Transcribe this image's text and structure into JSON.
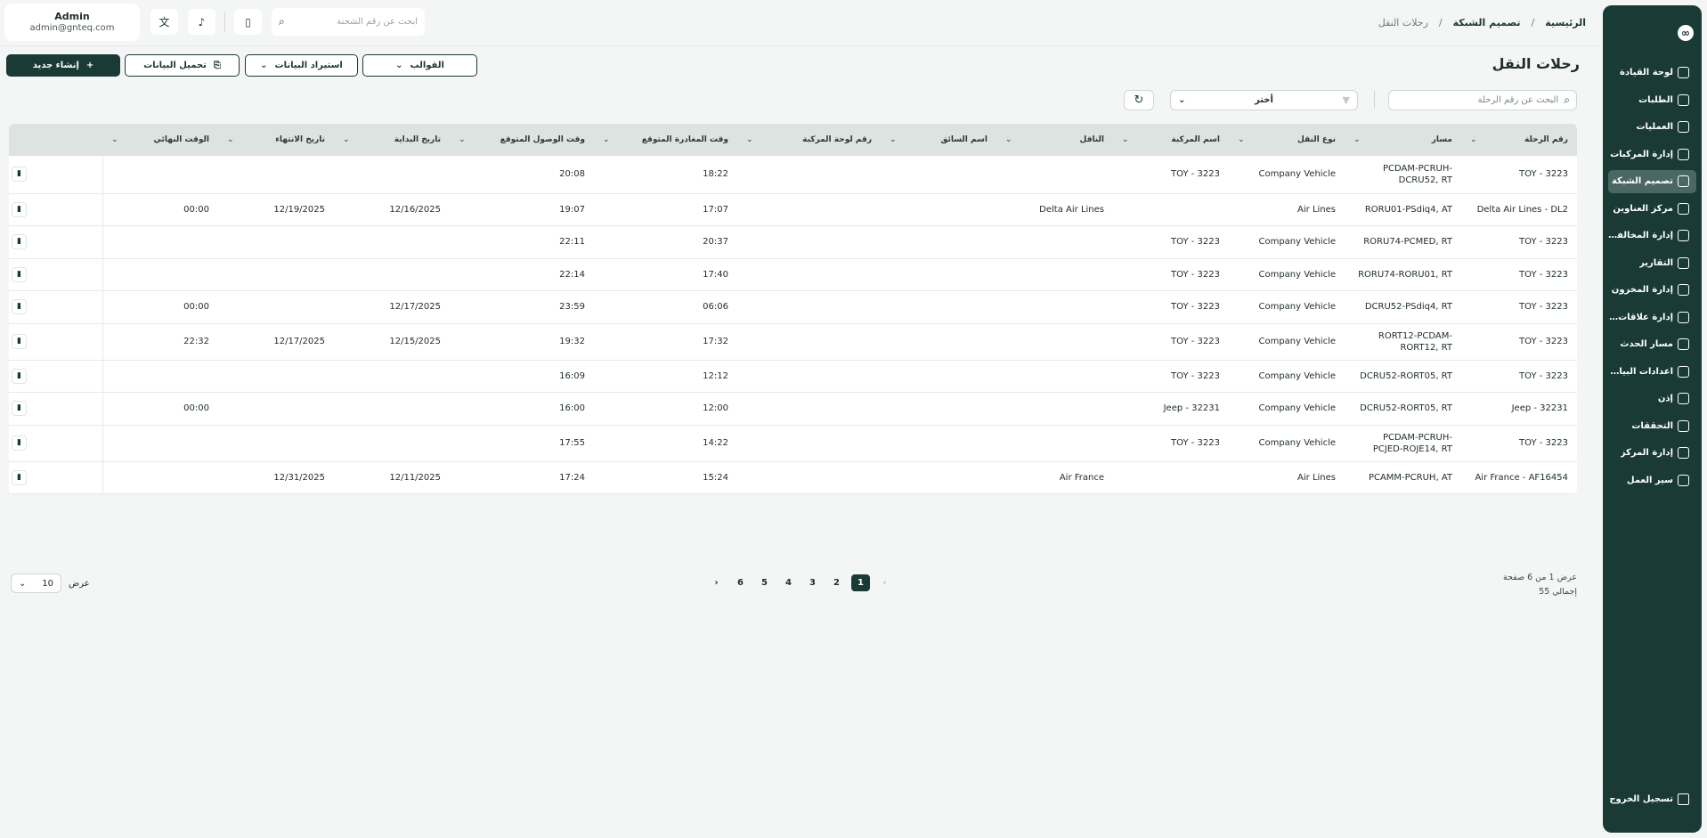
{
  "sidebar": {
    "logo": "∞",
    "items": [
      {
        "label": "لوحة القيادة",
        "icon": "dashboard-icon"
      },
      {
        "label": "الطلبات",
        "icon": "orders-icon"
      },
      {
        "label": "العمليات",
        "icon": "operations-icon"
      },
      {
        "label": "إدارة المركبات",
        "icon": "truck-icon"
      },
      {
        "label": "تصميم الشبكة",
        "icon": "network-icon",
        "active": true
      },
      {
        "label": "مركز العناوين",
        "icon": "location-icon"
      },
      {
        "label": "إدارة المخالفات",
        "icon": "violations-icon"
      },
      {
        "label": "التقارير",
        "icon": "reports-icon"
      },
      {
        "label": "إدارة المخزون",
        "icon": "inventory-icon"
      },
      {
        "label": "إدارة علاقات العملاء",
        "icon": "crm-icon"
      },
      {
        "label": "مسار الحدث",
        "icon": "route-icon"
      },
      {
        "label": "اعدادات البيانات...",
        "icon": "database-icon"
      },
      {
        "label": "إذن",
        "icon": "user-icon"
      },
      {
        "label": "التحققات",
        "icon": "tools-icon"
      },
      {
        "label": "إدارة المركز",
        "icon": "hub-icon"
      },
      {
        "label": "سير العمل",
        "icon": "workflow-icon"
      }
    ],
    "logout": "تسجيل الخروج"
  },
  "header": {
    "breadcrumb": [
      "الرئيسية",
      "/",
      "تصميم الشبكة",
      "/",
      "رحلات النقل"
    ],
    "search_placeholder": "ابحث عن رقم الشحنة",
    "user": {
      "name": "Admin",
      "email": "admin@gnteq.com"
    }
  },
  "page": {
    "title": "رحلات النقل",
    "buttons": {
      "templates": "القوالب",
      "import": "استيراد البيانات",
      "download": "تحميل البيانات",
      "create": "إنشاء جديد"
    },
    "search_placeholder": "البحث عن رقم الرحلة",
    "filter_value": "أختر"
  },
  "table": {
    "columns": [
      "رقم الرحلة",
      "مسار",
      "نوع النقل",
      "اسم المركبة",
      "الناقل",
      "اسم السائق",
      "رقم لوحة المركبة",
      "وقت المغادرة المتوقع",
      "وقت الوصول المتوقع",
      "تاريخ البداية",
      "تاريخ الانتهاء",
      "الوقت النهائي"
    ],
    "rows": [
      [
        "TOY - 3223",
        "PCDAM-PCRUH-DCRU52, RT",
        "Company Vehicle",
        "TOY - 3223",
        "",
        "",
        "",
        "18:22",
        "20:08",
        "",
        "",
        ""
      ],
      [
        "Delta Air Lines - DL2",
        "RORU01-PSdiq4, AT",
        "Air Lines",
        "",
        "Delta Air Lines",
        "",
        "",
        "17:07",
        "19:07",
        "12/16/2025",
        "12/19/2025",
        "00:00"
      ],
      [
        "TOY - 3223",
        "RORU74-PCMED, RT",
        "Company Vehicle",
        "TOY - 3223",
        "",
        "",
        "",
        "20:37",
        "22:11",
        "",
        "",
        ""
      ],
      [
        "TOY - 3223",
        "RORU74-RORU01, RT",
        "Company Vehicle",
        "TOY - 3223",
        "",
        "",
        "",
        "17:40",
        "22:14",
        "",
        "",
        ""
      ],
      [
        "TOY - 3223",
        "DCRU52-PSdiq4, RT",
        "Company Vehicle",
        "TOY - 3223",
        "",
        "",
        "",
        "06:06",
        "23:59",
        "12/17/2025",
        "",
        "00:00"
      ],
      [
        "TOY - 3223",
        "RORT12-PCDAM-RORT12, RT",
        "Company Vehicle",
        "TOY - 3223",
        "",
        "",
        "",
        "17:32",
        "19:32",
        "12/15/2025",
        "12/17/2025",
        "22:32"
      ],
      [
        "TOY - 3223",
        "DCRU52-RORT05, RT",
        "Company Vehicle",
        "TOY - 3223",
        "",
        "",
        "",
        "12:12",
        "16:09",
        "",
        "",
        ""
      ],
      [
        "Jeep - 32231",
        "DCRU52-RORT05, RT",
        "Company Vehicle",
        "Jeep - 32231",
        "",
        "",
        "",
        "12:00",
        "16:00",
        "",
        "",
        "00:00"
      ],
      [
        "TOY - 3223",
        "PCDAM-PCRUH-PCJED-ROJE14, RT",
        "Company Vehicle",
        "TOY - 3223",
        "",
        "",
        "",
        "14:22",
        "17:55",
        "",
        "",
        ""
      ],
      [
        "Air France - AF16454",
        "PCAMM-PCRUH, AT",
        "Air Lines",
        "",
        "Air France",
        "",
        "",
        "15:24",
        "17:24",
        "12/11/2025",
        "12/31/2025",
        ""
      ]
    ]
  },
  "pagination": {
    "info_line1": "عرض 1 من 6 صفحة",
    "info_line2": "إجمالي 55",
    "prev": "‹",
    "next": "›",
    "pages": [
      "1",
      "2",
      "3",
      "4",
      "5",
      "6"
    ],
    "current": "1",
    "page_size": "10",
    "page_size_label": "عرض"
  }
}
